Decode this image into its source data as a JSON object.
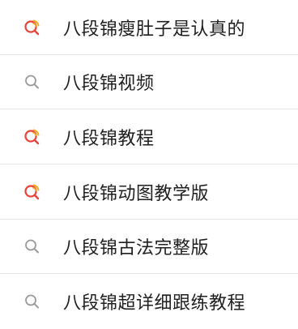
{
  "suggestions": [
    {
      "text": "八段锦瘦肚子是认真的",
      "icon": "hot-search-icon"
    },
    {
      "text": "八段锦视频",
      "icon": "search-icon"
    },
    {
      "text": "八段锦教程",
      "icon": "hot-search-icon"
    },
    {
      "text": "八段锦动图教学版",
      "icon": "hot-search-icon"
    },
    {
      "text": "八段锦古法完整版",
      "icon": "search-icon"
    },
    {
      "text": "八段锦超详细跟练教程",
      "icon": "search-icon"
    }
  ],
  "colors": {
    "hot_icon_red": "#e8423a",
    "hot_icon_orange": "#f5a623",
    "plain_icon_gray": "#9a9a9a",
    "text": "#1f1f1f",
    "divider": "#e6e6e6"
  }
}
